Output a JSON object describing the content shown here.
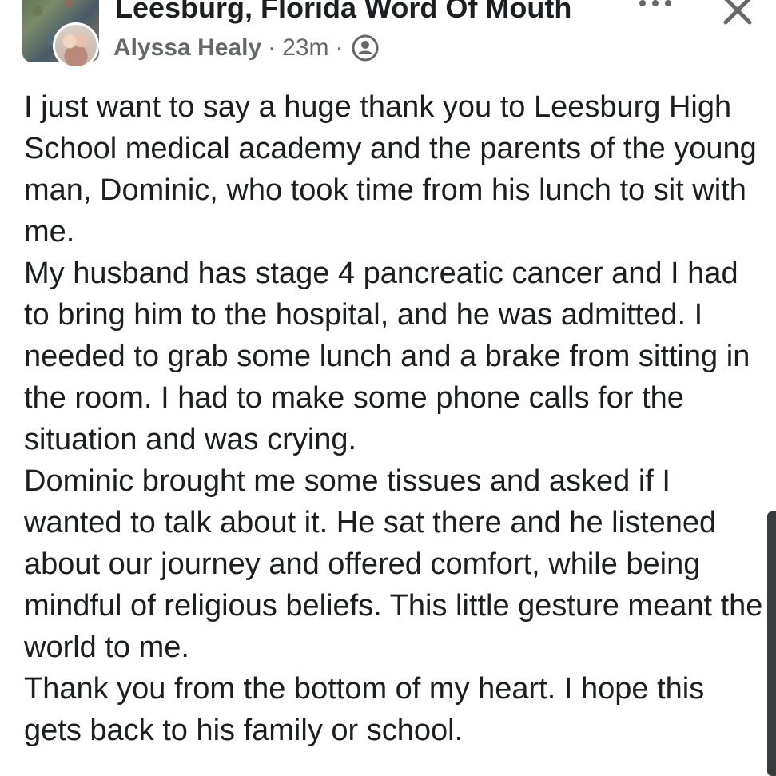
{
  "header": {
    "group_name": "Leesburg, Florida Word Of Mouth",
    "author": "Alyssa Healy",
    "separator": "·",
    "time": "23m",
    "audience_icon": "group-audience-icon",
    "more_icon": "more-options-icon",
    "close_icon": "close-icon"
  },
  "post": {
    "paragraphs": [
      "I just want to say a huge thank you to Leesburg High School medical academy and the parents of the young man, Dominic, who took time from his lunch to sit with me.",
      "My husband has stage 4 pancreatic cancer and I had to bring him to the hospital, and he was admitted. I needed to grab some lunch and a brake from sitting in the room. I had to make some phone calls for the situation and was crying.",
      "Dominic brought me some tissues and asked if I wanted to talk about it. He sat there and he listened about our journey and offered comfort, while being mindful of religious beliefs. This little gesture meant the world to me.",
      "Thank you from the bottom of my heart. I hope this gets back to his family or school."
    ]
  },
  "colors": {
    "text": "#1c1e21",
    "secondary_text": "#65676b",
    "scrollbar": "#3a3b3c"
  }
}
